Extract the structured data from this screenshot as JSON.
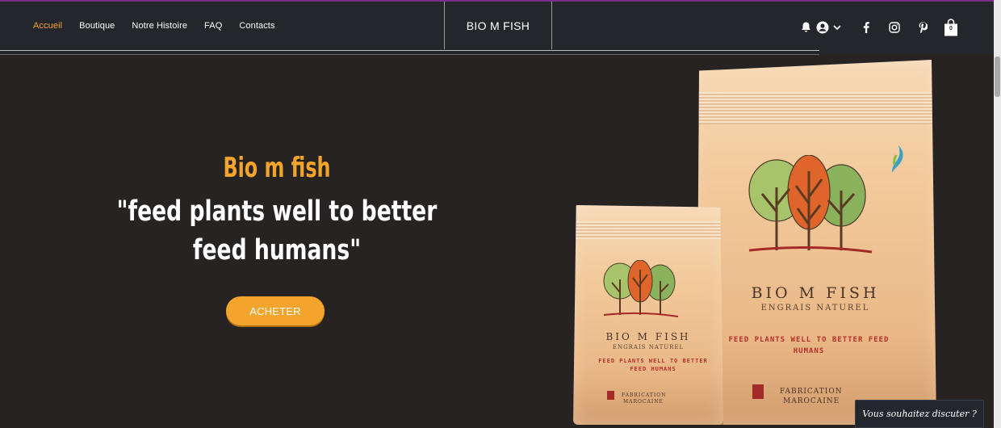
{
  "nav": {
    "items": [
      {
        "label": "Accueil",
        "active": true
      },
      {
        "label": "Boutique",
        "active": false
      },
      {
        "label": "Notre Histoire",
        "active": false
      },
      {
        "label": "FAQ",
        "active": false
      },
      {
        "label": "Contacts",
        "active": false
      }
    ]
  },
  "brand": {
    "name": "BIO M FISH"
  },
  "header_icons": [
    "bell-icon",
    "user-icon",
    "chevron-down-icon",
    "facebook-icon",
    "instagram-icon",
    "pinterest-icon",
    "shopping-bag-icon"
  ],
  "cart": {
    "count": "0"
  },
  "hero": {
    "title": "Bio m fish",
    "slogan": "\"feed plants well to better feed humans\"",
    "cta_label": "ACHETER"
  },
  "product": {
    "name": "BIO M FISH",
    "subtitle": "ENGRAIS NATUREL",
    "slogan": "FEED PLANTS WELL TO BETTER FEED HUMANS",
    "made_label_line1": "FABRICATION",
    "made_label_line2": "MAROCAINE"
  },
  "chat": {
    "label": "Vous souhaitez discuter ?"
  },
  "colors": {
    "accent": "#f3a42c",
    "header_bg": "#24262b",
    "hero_bg": "#272322"
  }
}
